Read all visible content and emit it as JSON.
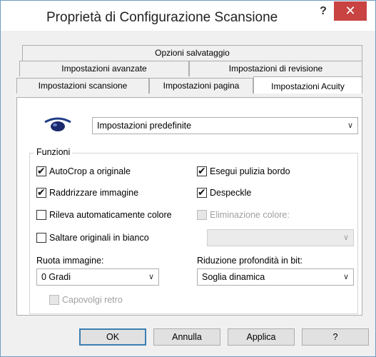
{
  "window": {
    "title": "Proprietà di Configurazione Scansione",
    "help_glyph": "?",
    "close_glyph": "✕"
  },
  "tabs": {
    "row1": [
      "Opzioni salvataggio"
    ],
    "row2": [
      "Impostazioni avanzate",
      "Impostazioni di revisione"
    ],
    "row3": [
      "Impostazioni scansione",
      "Impostazioni pagina",
      "Impostazioni Acuity"
    ],
    "active": "Impostazioni Acuity"
  },
  "preset": {
    "value": "Impostazioni predefinite",
    "icon": "eye-icon"
  },
  "funzioni": {
    "label": "Funzioni",
    "autocrop": {
      "label": "AutoCrop a originale",
      "checked": true
    },
    "raddrizzare": {
      "label": "Raddrizzare immagine",
      "checked": true
    },
    "rileva_colore": {
      "label": "Rileva automaticamente colore",
      "checked": false
    },
    "saltare_bianco": {
      "label": "Saltare originali in bianco",
      "checked": false
    },
    "pulizia_bordo": {
      "label": "Esegui pulizia bordo",
      "checked": true
    },
    "despeckle": {
      "label": "Despeckle",
      "checked": true
    },
    "eliminazione_colore": {
      "label": "Eliminazione colore:",
      "checked": false,
      "disabled": true
    },
    "eliminazione_value": "",
    "ruota_label": "Ruota immagine:",
    "ruota_value": "0 Gradi",
    "capovolgi": {
      "label": "Capovolgi retro",
      "checked": false,
      "disabled": true
    },
    "riduzione_label": "Riduzione profondità in bit:",
    "riduzione_value": "Soglia dinamica"
  },
  "buttons": {
    "ok": "OK",
    "annulla": "Annulla",
    "applica": "Applica",
    "help": "?"
  },
  "chevron": "∨",
  "checkmark": "✔"
}
